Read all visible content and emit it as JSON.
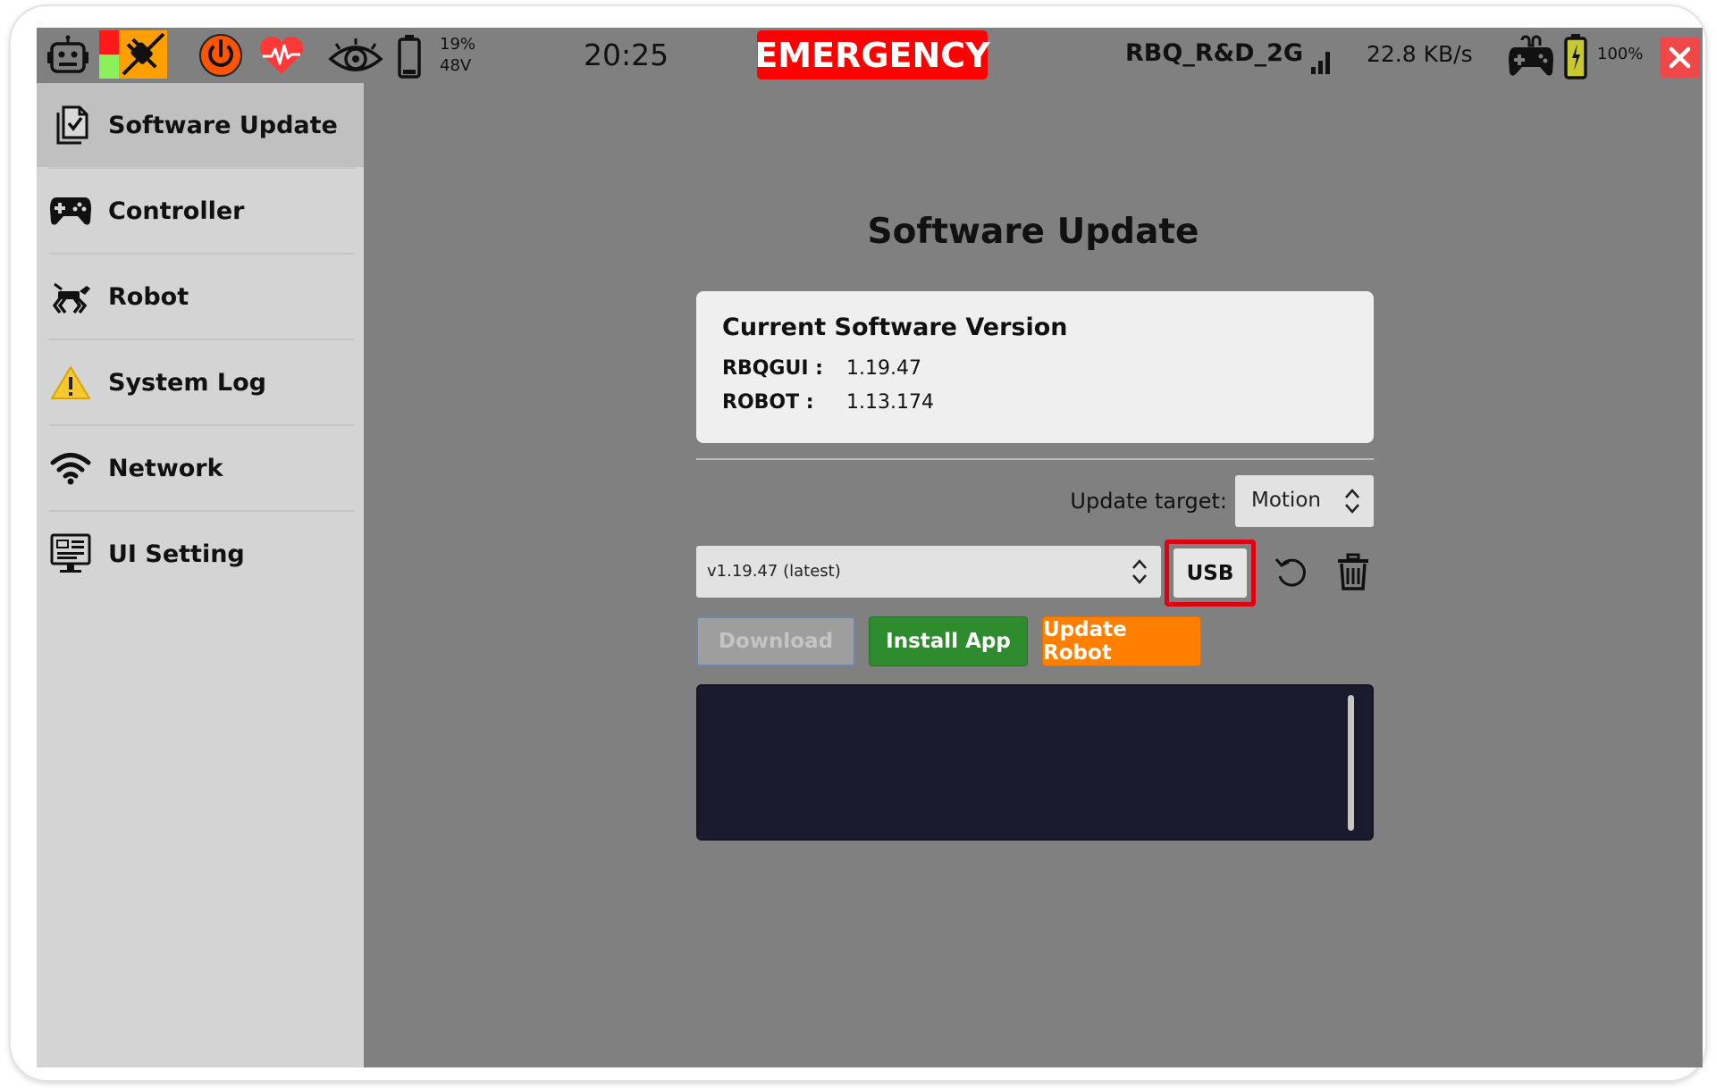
{
  "statusbar": {
    "battery_percent": "19%",
    "battery_voltage": "48V",
    "clock": "20:25",
    "emergency_label": "EMERGENCY",
    "network_name": "RBQ_R&D_2G",
    "throughput": "22.8 KB/s",
    "controller_battery": "100%",
    "icons": [
      "robot-icon",
      "power-plug-icon",
      "power-icon",
      "heartbeat-icon",
      "eye-icon",
      "battery-icon",
      "signal-icon",
      "gamepad-icon",
      "controller-battery-icon",
      "close-icon"
    ],
    "colors": {
      "emergency": "#ff0000",
      "close": "#f04848",
      "power": "#ff5500",
      "heartbeat": "#ff3838"
    }
  },
  "sidebar": {
    "items": [
      {
        "label": "Software Update",
        "icon": "software-update-icon",
        "active": true
      },
      {
        "label": "Controller",
        "icon": "gamepad-icon",
        "active": false
      },
      {
        "label": "Robot",
        "icon": "robot-dog-icon",
        "active": false
      },
      {
        "label": "System Log",
        "icon": "warning-icon",
        "active": false
      },
      {
        "label": "Network",
        "icon": "wifi-icon",
        "active": false
      },
      {
        "label": "UI Setting",
        "icon": "monitor-icon",
        "active": false
      }
    ]
  },
  "main": {
    "title": "Software Update",
    "card": {
      "title": "Current Software Version",
      "rows": [
        {
          "key": "RBQGUI :",
          "value": "1.19.47"
        },
        {
          "key": "ROBOT :",
          "value": "1.13.174"
        }
      ]
    },
    "update_target": {
      "label": "Update target:",
      "value": "Motion"
    },
    "version_select": {
      "value": "v1.19.47 (latest)"
    },
    "usb_label": "USB",
    "buttons": {
      "download": "Download",
      "install": "Install App",
      "update_robot": "Update Robot"
    },
    "colors": {
      "install": "#2e8b2e",
      "update_robot": "#ff8000",
      "console": "#1b1b2e",
      "highlight": "#e0000f"
    }
  }
}
